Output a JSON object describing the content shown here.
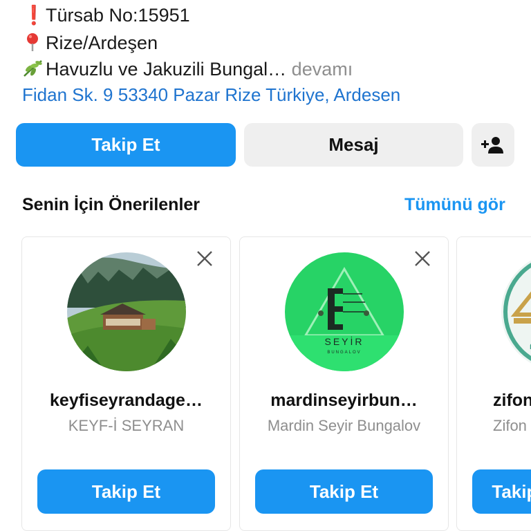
{
  "bio": {
    "line1": {
      "icon": "exclamation-icon",
      "icon_glyph": "❗",
      "text": "Türsab No:15951"
    },
    "line2": {
      "icon": "pin-icon",
      "icon_glyph": "📍",
      "text": "Rize/Ardeşen"
    },
    "line3": {
      "icon": "herb-icon",
      "icon_glyph": "🌿",
      "text": "Havuzlu ve Jakuzili Bungal…",
      "more": " devamı"
    },
    "address": "Fidan Sk. 9 53340 Pazar Rize Türkiye, Ardesen"
  },
  "actions": {
    "follow_label": "Takip Et",
    "message_label": "Mesaj",
    "add_person_icon": "add-person-icon"
  },
  "suggestions": {
    "title": "Senin İçin Önerilenler",
    "see_all": "Tümünü gör",
    "cards": [
      {
        "username": "keyfiseyrandage…",
        "full_name": "KEYF-İ SEYRAN",
        "follow_label": "Takip Et"
      },
      {
        "username": "mardinseyirbun…",
        "full_name": "Mardin Seyir Bungalov",
        "follow_label": "Takip Et",
        "logo_text": "SEYİR",
        "logo_sub": "BUNGALOV"
      },
      {
        "username": "zifon",
        "full_name": "Zifon",
        "follow_label": "Takip Et"
      }
    ]
  },
  "colors": {
    "accent": "#1a95f2",
    "link": "#1f74cf",
    "secondary_button": "#efefef",
    "muted_text": "#8e8e8e"
  }
}
